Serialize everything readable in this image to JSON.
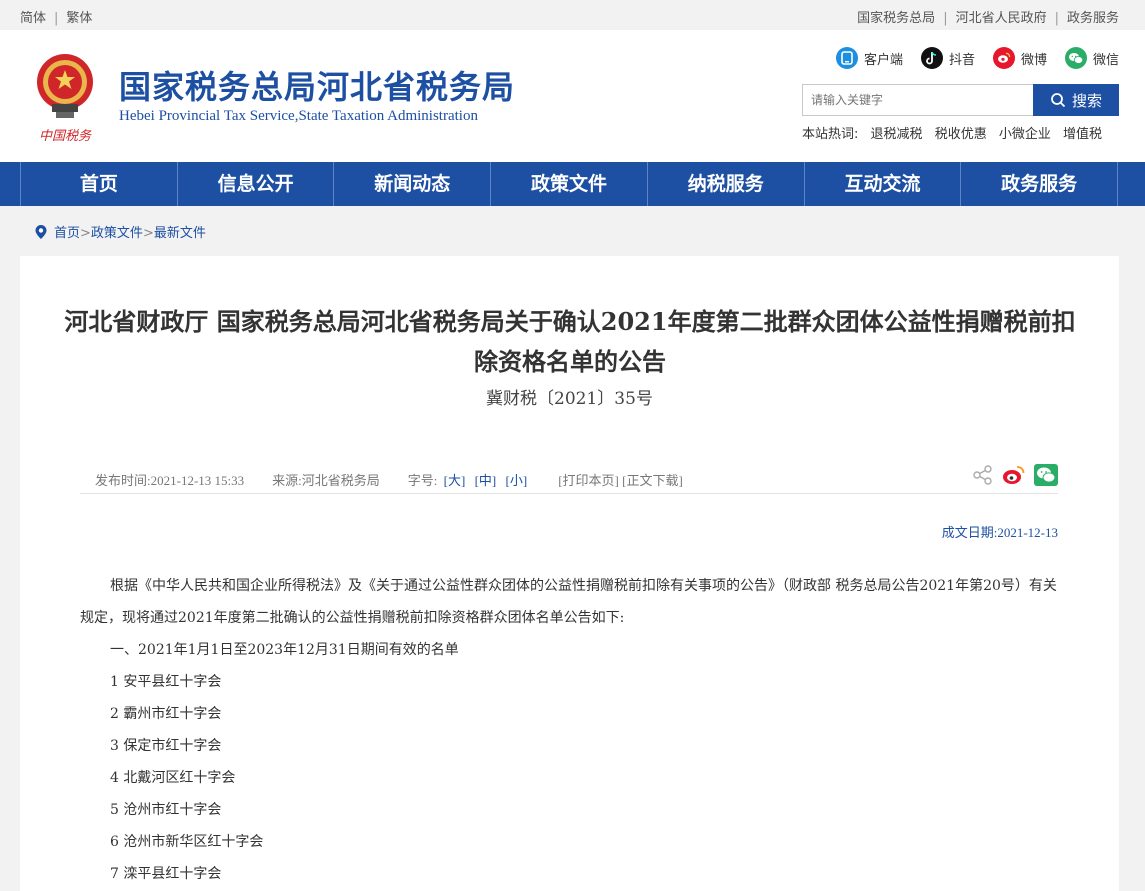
{
  "topbar": {
    "simplified": "简体",
    "traditional": "繁体",
    "links": [
      "国家税务总局",
      "河北省人民政府",
      "政务服务"
    ]
  },
  "header": {
    "title": "国家税务总局河北省税务局",
    "subtitle": "Hebei Provincial Tax Service,State Taxation Administration",
    "emblem_text": "中国税务"
  },
  "social": [
    {
      "label": "客户端",
      "icon": "client-icon",
      "color": "#1d8fe1"
    },
    {
      "label": "抖音",
      "icon": "douyin-icon",
      "color": "#111111"
    },
    {
      "label": "微博",
      "icon": "weibo-icon",
      "color": "#e6162d"
    },
    {
      "label": "微信",
      "icon": "wechat-icon",
      "color": "#2aae67"
    }
  ],
  "search": {
    "placeholder": "请输入关键字",
    "button": "搜索"
  },
  "hot": {
    "label": "本站热词:",
    "words": [
      "退税减税",
      "税收优惠",
      "小微企业",
      "增值税"
    ]
  },
  "nav": [
    "首页",
    "信息公开",
    "新闻动态",
    "政策文件",
    "纳税服务",
    "互动交流",
    "政务服务"
  ],
  "breadcrumb": [
    "首页",
    "政策文件",
    "最新文件"
  ],
  "article": {
    "title": "河北省财政厅 国家税务总局河北省税务局关于确认2021年度第二批群众团体公益性捐赠税前扣除资格名单的公告",
    "docno": "冀财税〔2021〕35号",
    "meta": {
      "publish_label": "发布时间:",
      "publish_time": "2021-12-13 15:33",
      "source_label": "来源:",
      "source": "河北省税务局",
      "size_label": "字号:",
      "size_large": "[大]",
      "size_medium": "[中]",
      "size_small": "[小]",
      "print": "[打印本页]",
      "download": "[正文下载]"
    },
    "date_label": "成文日期:",
    "date": "2021-12-13",
    "paragraph1": "根据《中华人民共和国企业所得税法》及《关于通过公益性群众团体的公益性捐赠税前扣除有关事项的公告》（财政部 税务总局公告2021年第20号）有关规定，现将通过2021年度第二批确认的公益性捐赠税前扣除资格群众团体名单公告如下:",
    "section1": "一、2021年1月1日至2023年12月31日期间有效的名单",
    "list": [
      "1 安平县红十字会",
      "2 霸州市红十字会",
      "3 保定市红十字会",
      "4 北戴河区红十字会",
      "5 沧州市红十字会",
      "6 沧州市新华区红十字会",
      "7 滦平县红十字会"
    ]
  },
  "colors": {
    "brand": "#1d4fa3",
    "background": "#f2f2f2"
  }
}
